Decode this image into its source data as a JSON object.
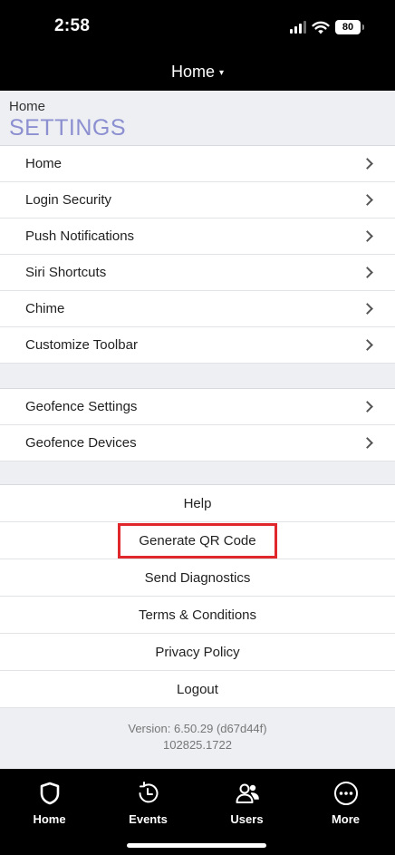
{
  "status_bar": {
    "time": "2:58",
    "battery": "80"
  },
  "nav": {
    "title": "Home",
    "caret": "▾"
  },
  "header": {
    "breadcrumb": "Home",
    "title": "SETTINGS"
  },
  "settings_group_1": [
    {
      "label": "Home"
    },
    {
      "label": "Login Security"
    },
    {
      "label": "Push Notifications"
    },
    {
      "label": "Siri Shortcuts"
    },
    {
      "label": "Chime"
    },
    {
      "label": "Customize Toolbar"
    }
  ],
  "settings_group_2": [
    {
      "label": "Geofence Settings"
    },
    {
      "label": "Geofence Devices"
    }
  ],
  "actions": {
    "help": "Help",
    "generate_qr": "Generate QR Code",
    "send_diagnostics": "Send Diagnostics",
    "terms": "Terms & Conditions",
    "privacy": "Privacy Policy",
    "logout": "Logout"
  },
  "version": {
    "line1": "Version: 6.50.29 (d67d44f)",
    "line2": "102825.1722"
  },
  "tabs": [
    {
      "label": "Home",
      "icon": "shield-icon"
    },
    {
      "label": "Events",
      "icon": "clock-history-icon"
    },
    {
      "label": "Users",
      "icon": "users-icon"
    },
    {
      "label": "More",
      "icon": "more-icon"
    }
  ],
  "colors": {
    "accent": "#8c8fd0",
    "highlight": "#e0282c",
    "background": "#edeff3"
  }
}
